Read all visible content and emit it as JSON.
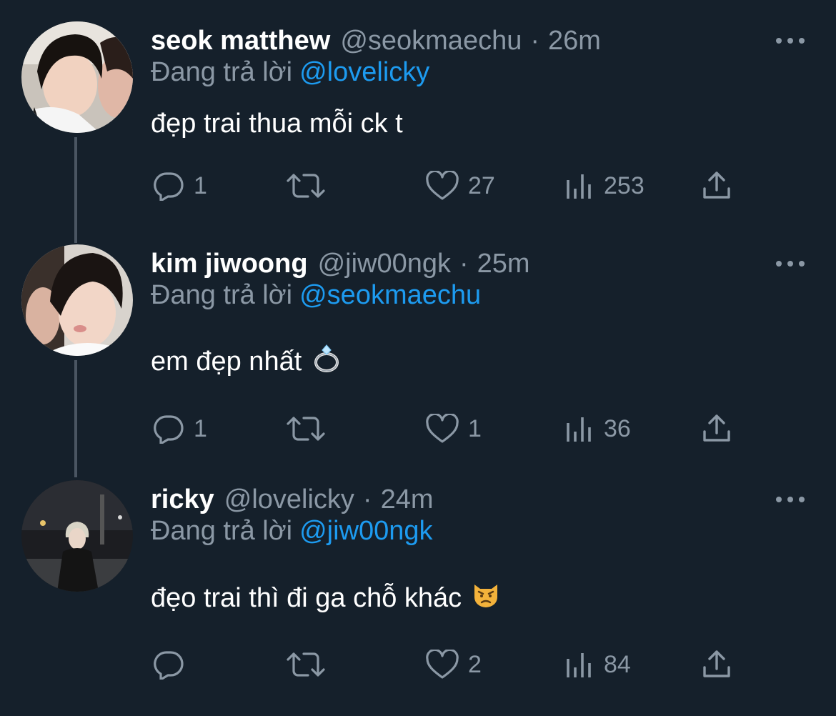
{
  "colors": {
    "background": "#15202b",
    "primary_text": "#ffffff",
    "secondary_text": "#8b98a5",
    "accent": "#1d9bf0",
    "thread_line": "#4a5562"
  },
  "tweets": [
    {
      "display_name": "seok matthew",
      "handle": "@seokmaechu",
      "separator": "·",
      "time": "26m",
      "replying_prefix": "Đang trả lời",
      "replying_to": "@lovelicky",
      "text": "đẹp trai thua mỗi ck t",
      "emoji": "",
      "reply_count": "1",
      "retweet_count": "",
      "like_count": "27",
      "view_count": "253",
      "avatar_icon": "avatar-photo-two-people"
    },
    {
      "display_name": "kim jiwoong",
      "handle": "@jiw00ngk",
      "separator": "·",
      "time": "25m",
      "replying_prefix": "Đang trả lời",
      "replying_to": "@seokmaechu",
      "text": "em đẹp nhất",
      "emoji": "ring-emoji",
      "reply_count": "1",
      "retweet_count": "",
      "like_count": "1",
      "view_count": "36",
      "avatar_icon": "avatar-photo-two-people"
    },
    {
      "display_name": "ricky",
      "handle": "@lovelicky",
      "separator": "·",
      "time": "24m",
      "replying_prefix": "Đang trả lời",
      "replying_to": "@jiw00ngk",
      "text": "đẹo trai thì đi ga chỗ khác",
      "emoji": "pouting-cat-emoji",
      "reply_count": "",
      "retweet_count": "",
      "like_count": "2",
      "view_count": "84",
      "avatar_icon": "avatar-photo-night-street"
    }
  ]
}
